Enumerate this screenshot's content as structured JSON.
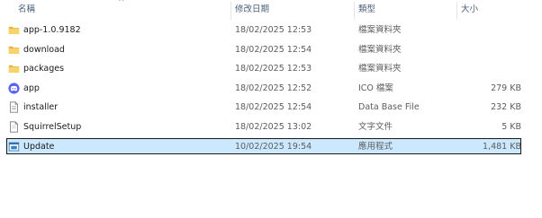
{
  "columns": {
    "name": "名稱",
    "date": "修改日期",
    "type": "類型",
    "size": "大小"
  },
  "files": [
    {
      "name": "app-1.0.9182",
      "date": "18/02/2025 12:53",
      "type": "檔案資料夾",
      "size": "",
      "icon": "folder-icon"
    },
    {
      "name": "download",
      "date": "18/02/2025 12:54",
      "type": "檔案資料夾",
      "size": "",
      "icon": "folder-icon"
    },
    {
      "name": "packages",
      "date": "18/02/2025 12:53",
      "type": "檔案資料夾",
      "size": "",
      "icon": "folder-icon"
    },
    {
      "name": "app",
      "date": "18/02/2025 12:52",
      "type": "ICO 檔案",
      "size": "279 KB",
      "icon": "app-discord-icon"
    },
    {
      "name": "installer",
      "date": "18/02/2025 12:54",
      "type": "Data Base File",
      "size": "232 KB",
      "icon": "database-file-icon"
    },
    {
      "name": "SquirrelSetup",
      "date": "18/02/2025 13:02",
      "type": "文字文件",
      "size": "5 KB",
      "icon": "text-file-icon"
    },
    {
      "name": "Update",
      "date": "10/02/2025 19:54",
      "type": "應用程式",
      "size": "1,481 KB",
      "icon": "application-icon",
      "selected": true
    }
  ],
  "colors": {
    "folder": "#f3c948",
    "selection": "#cce8ff",
    "discord": "#5865f2"
  }
}
